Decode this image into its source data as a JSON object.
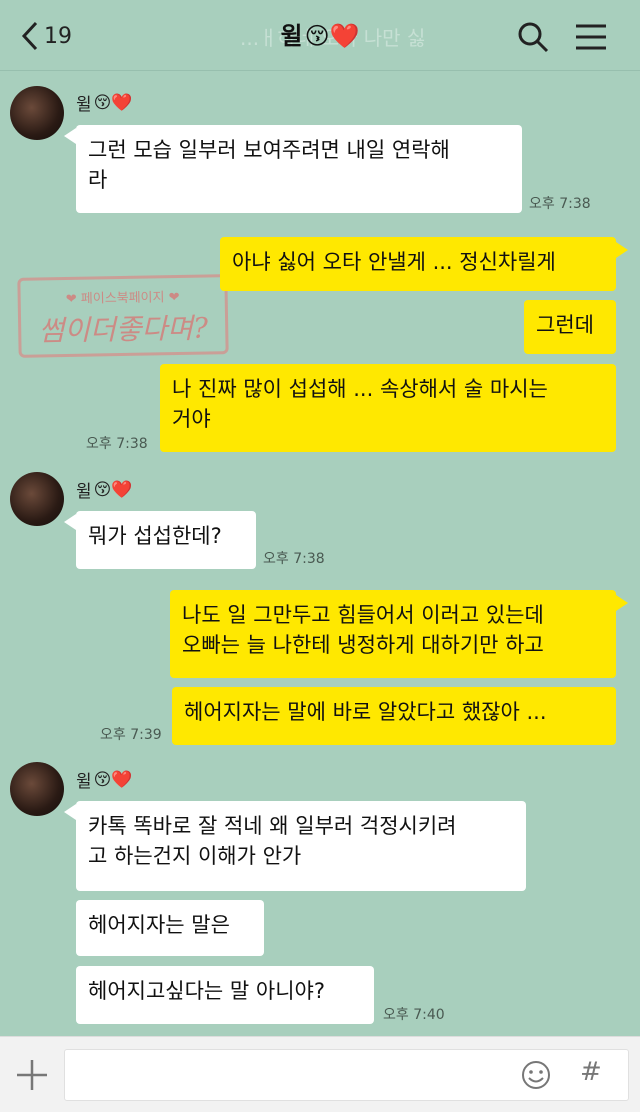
{
  "header": {
    "back_count": "19",
    "title_name": "윌",
    "title_emoji": "😚❤️",
    "watermark_text": "...ㅐ하네 오빠 나만 싫"
  },
  "stamp": {
    "top_text": "❤ 페이스북페이지 ❤",
    "main_text": "썸이더좋다며?"
  },
  "contact": {
    "name": "윌",
    "emoji": "😚❤️"
  },
  "messages": {
    "m1": "그런 모습 일부러 보여주려면 내일 연락해\n라",
    "t1": "오후 7:38",
    "m2": "아냐 싫어 오타 안낼게 ... 정신차릴게",
    "m3": "그런데",
    "m4": "나 진짜 많이 섭섭해 ... 속상해서 술 마시는\n거야",
    "t2": "오후 7:38",
    "m5": "뭐가 섭섭한데?",
    "t3": "오후 7:38",
    "m6": "나도 일 그만두고 힘들어서 이러고 있는데\n오빠는 늘 나한테 냉정하게 대하기만 하고",
    "m7": "헤어지자는 말에 바로 알았다고 했잖아 ...",
    "t4": "오후 7:39",
    "m8": "카톡 똑바로 잘 적네 왜 일부러 걱정시키려\n고 하는건지 이해가 안가",
    "m9": "헤어지자는 말은",
    "m10": "헤어지고싶다는 말 아니야?",
    "t5": "오후 7:40"
  },
  "input": {
    "hash": "#"
  },
  "colors": {
    "background": "#a8cfbd",
    "outgoing_bubble": "#ffe800",
    "incoming_bubble": "#ffffff"
  }
}
